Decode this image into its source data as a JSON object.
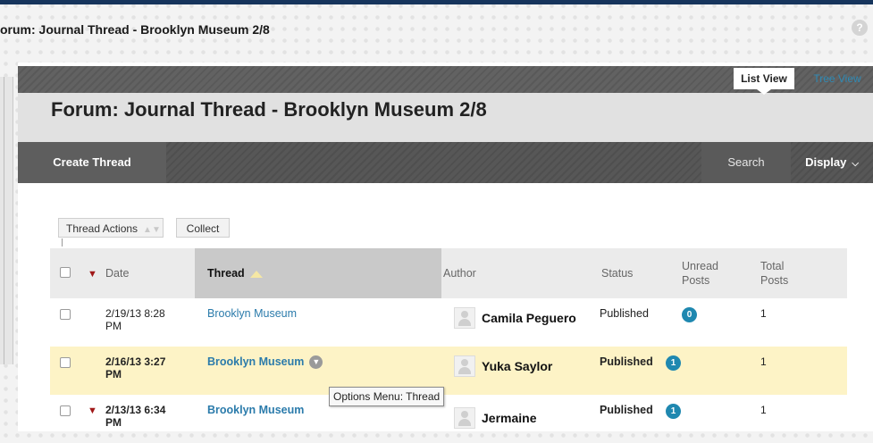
{
  "breadcrumb": "orum: Journal Thread - Brooklyn Museum 2/8",
  "help_label": "?",
  "page_title": "Forum: Journal Thread - Brooklyn Museum 2/8",
  "view_tabs": {
    "list": "List View",
    "tree": "Tree View"
  },
  "action_bar": {
    "create": "Create Thread",
    "search": "Search",
    "display": "Display"
  },
  "buttons": {
    "thread_actions": "Thread Actions",
    "collect": "Collect"
  },
  "columns": {
    "date": "Date",
    "thread": "Thread",
    "author": "Author",
    "status": "Status",
    "unread": "Unread Posts",
    "total": "Total Posts"
  },
  "rows": [
    {
      "date": "2/19/13 8:28 PM",
      "thread": "Brooklyn Museum",
      "author": "Camila Peguero",
      "status": "Published",
      "unread": "0",
      "total": "1",
      "flagged": false,
      "unread_state": false
    },
    {
      "date": "2/16/13 3:27 PM",
      "thread": "Brooklyn Museum",
      "author": "Yuka Saylor",
      "status": "Published",
      "unread": "1",
      "total": "1",
      "flagged": false,
      "unread_state": true
    },
    {
      "date": "2/13/13 6:34 PM",
      "thread": "Brooklyn Museum",
      "author": "Jermaine",
      "status": "Published",
      "unread": "1",
      "total": "1",
      "flagged": true,
      "unread_state": true
    }
  ],
  "tooltip": "Options Menu: Thread",
  "colors": {
    "link": "#2b7bab",
    "badge": "#1f88b0",
    "highlight": "#fdf3c6",
    "header_bar": "#16345c"
  }
}
